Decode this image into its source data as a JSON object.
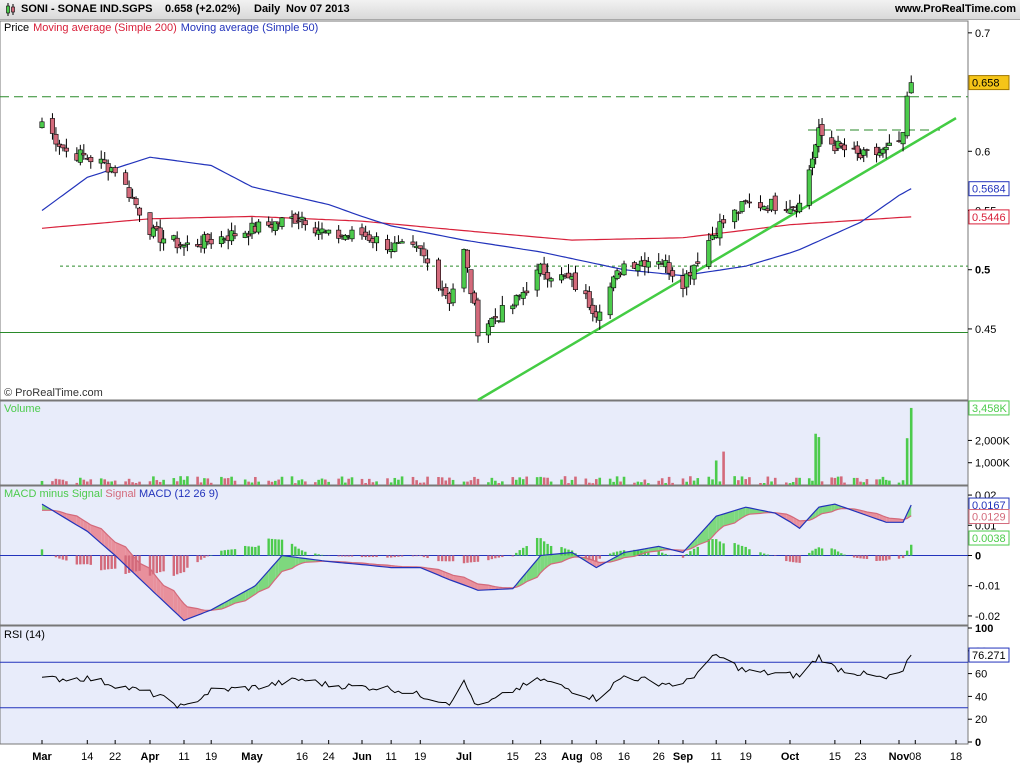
{
  "header": {
    "symbol": "SONI - SONAE IND.SGPS",
    "quote": "0.658 (+2.02%)",
    "period": "Daily",
    "date": "Nov 07 2013",
    "website": "www.ProRealTime.com"
  },
  "colors": {
    "panel_bg": "#e8ecfa",
    "up_candle": "#4ccb4c",
    "down_candle": "#d36a7b",
    "ma200": "#d8203a",
    "ma50": "#2233bb",
    "trendline": "#44cc44",
    "macd": "#2233bb",
    "signal": "#d36a7b"
  },
  "chart_data": [
    {
      "type": "candlestick",
      "panel": "price",
      "legend": [
        {
          "text": "Price",
          "color": "#000000"
        },
        {
          "text": "Moving average (Simple 200)",
          "color": "#d8203a"
        },
        {
          "text": "Moving average (Simple 50)",
          "color": "#2233bb"
        }
      ],
      "copyright": "© ProRealTime.com",
      "y_ticks": [
        "0.7",
        "0.6",
        "0.55",
        "0.5",
        "0.45"
      ],
      "ylim": [
        0.39,
        0.71
      ],
      "value_tags": [
        {
          "text": "0.658",
          "value": 0.658,
          "style": "filled",
          "color": "#f5c518"
        },
        {
          "text": "0.5684",
          "value": 0.5684,
          "style": "outline",
          "color": "#2233bb"
        },
        {
          "text": "0.5446",
          "value": 0.5446,
          "style": "outline",
          "color": "#d8203a"
        }
      ],
      "horizontal_lines": [
        {
          "value": 0.646,
          "style": "dashed"
        },
        {
          "value": 0.618,
          "style": "dashed-short"
        },
        {
          "value": 0.503,
          "style": "dotted"
        },
        {
          "value": 0.447,
          "style": "solid"
        }
      ],
      "trendline": {
        "from_date": "Jul 05 2013",
        "from_value": 0.39,
        "to_date": "Nov 18 2013",
        "to_value": 0.628
      },
      "closes_anchor": [
        {
          "date": "Mar 01",
          "value": 0.625
        },
        {
          "date": "Mar 08",
          "value": 0.6
        },
        {
          "date": "Mar 14",
          "value": 0.595
        },
        {
          "date": "Mar 22",
          "value": 0.585
        },
        {
          "date": "Apr 02",
          "value": 0.53
        },
        {
          "date": "Apr 11",
          "value": 0.52
        },
        {
          "date": "Apr 19",
          "value": 0.525
        },
        {
          "date": "May 02",
          "value": 0.535
        },
        {
          "date": "May 16",
          "value": 0.545
        },
        {
          "date": "May 24",
          "value": 0.528
        },
        {
          "date": "Jun 03",
          "value": 0.53
        },
        {
          "date": "Jun 11",
          "value": 0.52
        },
        {
          "date": "Jun 19",
          "value": 0.515
        },
        {
          "date": "Jun 27",
          "value": 0.475
        },
        {
          "date": "Jul 01",
          "value": 0.515
        },
        {
          "date": "Jul 05",
          "value": 0.45
        },
        {
          "date": "Jul 15",
          "value": 0.47
        },
        {
          "date": "Jul 23",
          "value": 0.5
        },
        {
          "date": "Aug 01",
          "value": 0.49
        },
        {
          "date": "Aug 08",
          "value": 0.465
        },
        {
          "date": "Aug 16",
          "value": 0.505
        },
        {
          "date": "Aug 26",
          "value": 0.51
        },
        {
          "date": "Sep 02",
          "value": 0.49
        },
        {
          "date": "Sep 11",
          "value": 0.535
        },
        {
          "date": "Sep 19",
          "value": 0.555
        },
        {
          "date": "Sep 27",
          "value": 0.555
        },
        {
          "date": "Oct 04",
          "value": 0.555
        },
        {
          "date": "Oct 10",
          "value": 0.615
        },
        {
          "date": "Oct 15",
          "value": 0.605
        },
        {
          "date": "Oct 23",
          "value": 0.595
        },
        {
          "date": "Oct 31",
          "value": 0.6
        },
        {
          "date": "Nov 05",
          "value": 0.61
        },
        {
          "date": "Nov 06",
          "value": 0.645
        },
        {
          "date": "Nov 07",
          "value": 0.658
        }
      ]
    },
    {
      "type": "bar",
      "panel": "volume",
      "title": "Volume",
      "y_ticks": [
        "2,000K",
        "1,000K"
      ],
      "ylim": [
        0,
        3500
      ],
      "value_tags": [
        {
          "text": "3,458K",
          "value": 3458,
          "color": "#4ccb4c"
        }
      ],
      "notable_values": [
        {
          "date": "Sep 11",
          "value": 1100
        },
        {
          "date": "Sep 13",
          "value": 1500
        },
        {
          "date": "Oct 09",
          "value": 2300
        },
        {
          "date": "Oct 10",
          "value": 2150
        },
        {
          "date": "Nov 06",
          "value": 2100
        },
        {
          "date": "Nov 07",
          "value": 3458
        }
      ]
    },
    {
      "type": "area",
      "panel": "macd",
      "legend": [
        {
          "text": "MACD minus Signal",
          "color": "#4ccb4c"
        },
        {
          "text": "Signal",
          "color": "#d36a7b"
        },
        {
          "text": "MACD (12 26 9)",
          "color": "#2233bb"
        }
      ],
      "y_ticks": [
        "0.02",
        "0.01",
        "0",
        "-0.01",
        "-0.02"
      ],
      "ylim": [
        -0.023,
        0.023
      ],
      "value_tags": [
        {
          "text": "0.0167",
          "value": 0.0167,
          "color": "#2233bb"
        },
        {
          "text": "0.0129",
          "value": 0.0129,
          "color": "#d36a7b"
        },
        {
          "text": "0.0038",
          "value": 0.0038,
          "color": "#4ccb4c"
        }
      ],
      "macd_anchor": [
        {
          "date": "Mar 01",
          "value": 0.017
        },
        {
          "date": "Mar 14",
          "value": 0.008
        },
        {
          "date": "Mar 22",
          "value": 0.0
        },
        {
          "date": "Apr 02",
          "value": -0.012
        },
        {
          "date": "Apr 11",
          "value": -0.0215
        },
        {
          "date": "Apr 19",
          "value": -0.018
        },
        {
          "date": "May 02",
          "value": -0.01
        },
        {
          "date": "May 10",
          "value": 0.0
        },
        {
          "date": "May 24",
          "value": -0.002
        },
        {
          "date": "Jun 03",
          "value": -0.003
        },
        {
          "date": "Jun 11",
          "value": -0.004
        },
        {
          "date": "Jun 19",
          "value": -0.004
        },
        {
          "date": "Jun 27",
          "value": -0.008
        },
        {
          "date": "Jul 05",
          "value": -0.0115
        },
        {
          "date": "Jul 15",
          "value": -0.011
        },
        {
          "date": "Jul 23",
          "value": 0.0
        },
        {
          "date": "Aug 01",
          "value": 0.001
        },
        {
          "date": "Aug 08",
          "value": -0.004
        },
        {
          "date": "Aug 16",
          "value": 0.001
        },
        {
          "date": "Aug 26",
          "value": 0.003
        },
        {
          "date": "Sep 02",
          "value": 0.001
        },
        {
          "date": "Sep 11",
          "value": 0.013
        },
        {
          "date": "Sep 19",
          "value": 0.016
        },
        {
          "date": "Sep 27",
          "value": 0.014
        },
        {
          "date": "Oct 04",
          "value": 0.009
        },
        {
          "date": "Oct 10",
          "value": 0.016
        },
        {
          "date": "Oct 15",
          "value": 0.017
        },
        {
          "date": "Oct 23",
          "value": 0.014
        },
        {
          "date": "Oct 31",
          "value": 0.011
        },
        {
          "date": "Nov 05",
          "value": 0.011
        },
        {
          "date": "Nov 07",
          "value": 0.0167
        }
      ]
    },
    {
      "type": "line",
      "panel": "rsi",
      "title": "RSI (14)",
      "y_ticks": [
        "100",
        "80",
        "60",
        "40",
        "20",
        "0"
      ],
      "ylim": [
        0,
        100
      ],
      "reference_lines": [
        70,
        30
      ],
      "value_tags": [
        {
          "text": "76.271",
          "value": 76.271,
          "color": "#2233bb"
        }
      ],
      "rsi_anchor": [
        {
          "date": "Mar 01",
          "value": 55
        },
        {
          "date": "Mar 14",
          "value": 56
        },
        {
          "date": "Apr 02",
          "value": 42
        },
        {
          "date": "Apr 11",
          "value": 30
        },
        {
          "date": "Apr 19",
          "value": 45
        },
        {
          "date": "May 02",
          "value": 48
        },
        {
          "date": "May 16",
          "value": 55
        },
        {
          "date": "May 24",
          "value": 50
        },
        {
          "date": "Jun 11",
          "value": 47
        },
        {
          "date": "Jun 27",
          "value": 35
        },
        {
          "date": "Jul 01",
          "value": 52
        },
        {
          "date": "Jul 05",
          "value": 30
        },
        {
          "date": "Jul 15",
          "value": 45
        },
        {
          "date": "Jul 23",
          "value": 55
        },
        {
          "date": "Aug 08",
          "value": 38
        },
        {
          "date": "Aug 16",
          "value": 58
        },
        {
          "date": "Aug 26",
          "value": 52
        },
        {
          "date": "Sep 02",
          "value": 50
        },
        {
          "date": "Sep 11",
          "value": 76
        },
        {
          "date": "Sep 19",
          "value": 62
        },
        {
          "date": "Oct 04",
          "value": 58
        },
        {
          "date": "Oct 10",
          "value": 75
        },
        {
          "date": "Oct 15",
          "value": 65
        },
        {
          "date": "Oct 31",
          "value": 55
        },
        {
          "date": "Nov 05",
          "value": 62
        },
        {
          "date": "Nov 07",
          "value": 76.271
        }
      ]
    }
  ],
  "x_axis": {
    "ticks": [
      {
        "label": "Mar",
        "bold": true
      },
      {
        "label": "14",
        "bold": false
      },
      {
        "label": "22",
        "bold": false
      },
      {
        "label": "Apr",
        "bold": true
      },
      {
        "label": "11",
        "bold": false
      },
      {
        "label": "19",
        "bold": false
      },
      {
        "label": "May",
        "bold": true
      },
      {
        "label": "16",
        "bold": false
      },
      {
        "label": "24",
        "bold": false
      },
      {
        "label": "Jun",
        "bold": true
      },
      {
        "label": "11",
        "bold": false
      },
      {
        "label": "19",
        "bold": false
      },
      {
        "label": "Jul",
        "bold": true
      },
      {
        "label": "15",
        "bold": false
      },
      {
        "label": "23",
        "bold": false
      },
      {
        "label": "Aug",
        "bold": true
      },
      {
        "label": "08",
        "bold": false
      },
      {
        "label": "16",
        "bold": false
      },
      {
        "label": "26",
        "bold": false
      },
      {
        "label": "Sep",
        "bold": true
      },
      {
        "label": "11",
        "bold": false
      },
      {
        "label": "19",
        "bold": false
      },
      {
        "label": "Oct",
        "bold": true
      },
      {
        "label": "15",
        "bold": false
      },
      {
        "label": "23",
        "bold": false
      },
      {
        "label": "Nov",
        "bold": true
      },
      {
        "label": "08",
        "bold": false
      },
      {
        "label": "18",
        "bold": false
      }
    ]
  }
}
